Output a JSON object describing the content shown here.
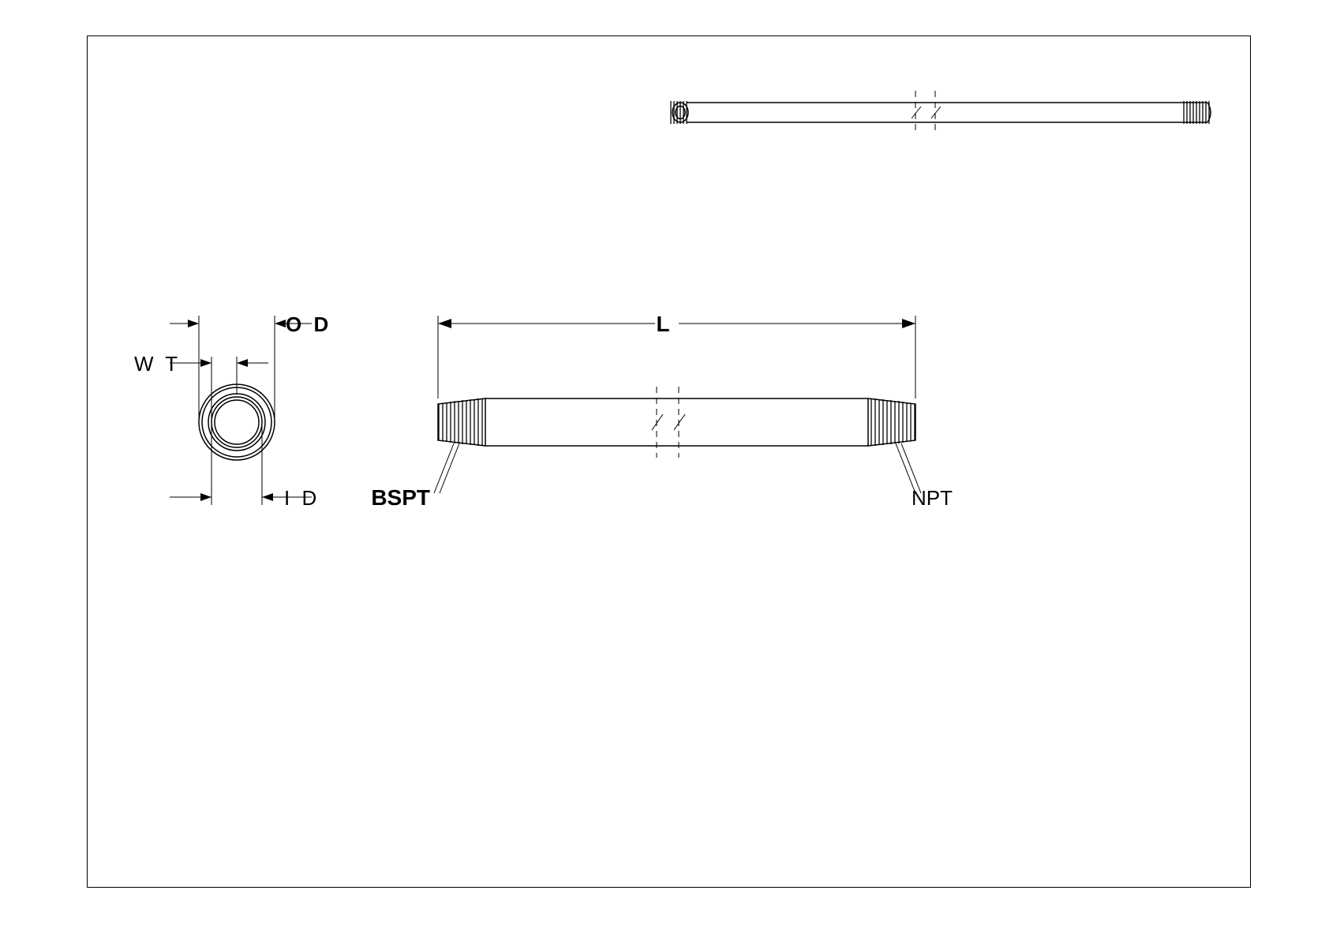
{
  "labels": {
    "od": "O D",
    "id": "I D",
    "wt": "W T",
    "length": "L",
    "bspt": "BSPT",
    "npt": "NPT"
  }
}
